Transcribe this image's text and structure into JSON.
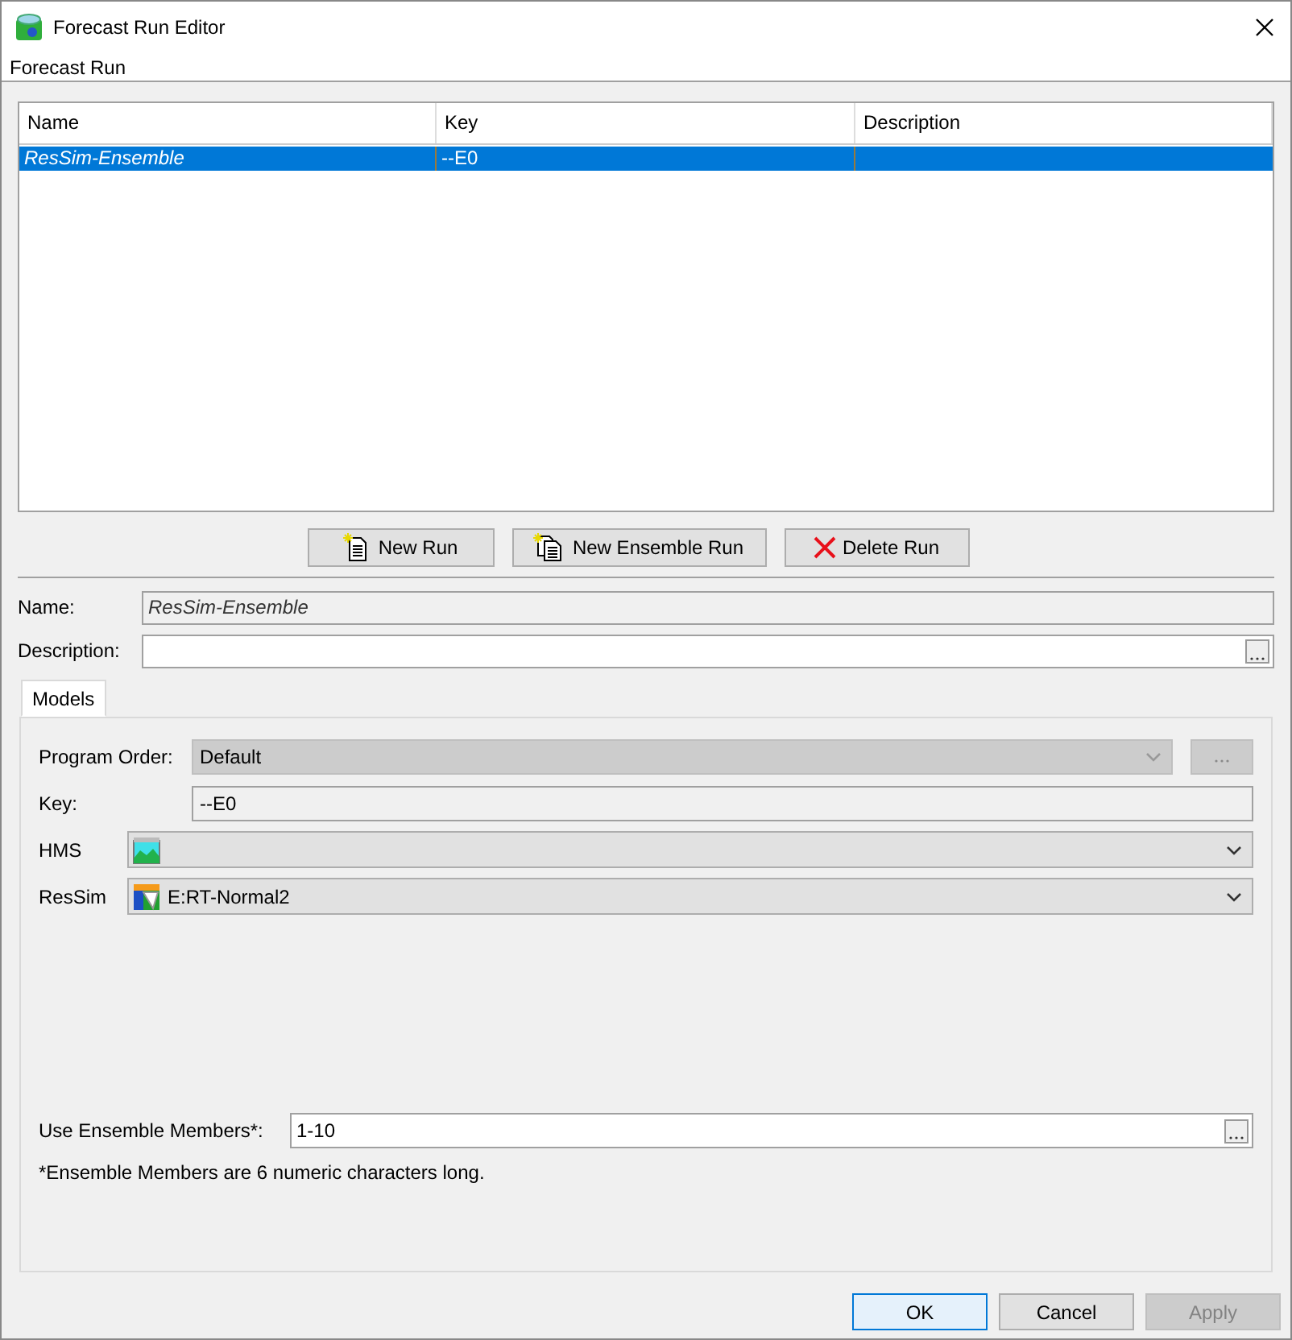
{
  "window": {
    "title": "Forecast Run Editor"
  },
  "menu": [
    "Forecast Run"
  ],
  "table": {
    "columns": [
      "Name",
      "Key",
      "Description"
    ],
    "rows": [
      {
        "cells": [
          "ResSim-Ensemble",
          "--E0",
          ""
        ],
        "selected": true
      }
    ]
  },
  "run_buttons": [
    {
      "label": "New Run",
      "kind": "new"
    },
    {
      "label": "New Ensemble Run",
      "kind": "ensemble"
    },
    {
      "label": "Delete Run",
      "kind": "delete"
    }
  ],
  "name": {
    "label": "Name:",
    "value": "ResSim-Ensemble",
    "disabled": true
  },
  "description": {
    "label": "Description:"
  },
  "tabs": [
    {
      "label": "Models",
      "selected": true
    }
  ],
  "models": {
    "program_order": {
      "label": "Program Order:",
      "value": "Default",
      "disabled": true
    },
    "key": {
      "label": "Key:",
      "value": "--E0"
    },
    "hms": {
      "label": "HMS"
    },
    "ressim": {
      "label": "ResSim",
      "value": "E:RT-Normal2"
    },
    "ensemble": {
      "label": "Use Ensemble Members*:",
      "value": "1-10"
    },
    "note": "*Ensemble Members are 6 numeric characters long."
  },
  "dialog_buttons": [
    {
      "label": "OK",
      "disabled": false,
      "default": true
    },
    {
      "label": "Cancel",
      "disabled": false,
      "default": false
    },
    {
      "label": "Apply",
      "disabled": true,
      "default": false
    }
  ]
}
